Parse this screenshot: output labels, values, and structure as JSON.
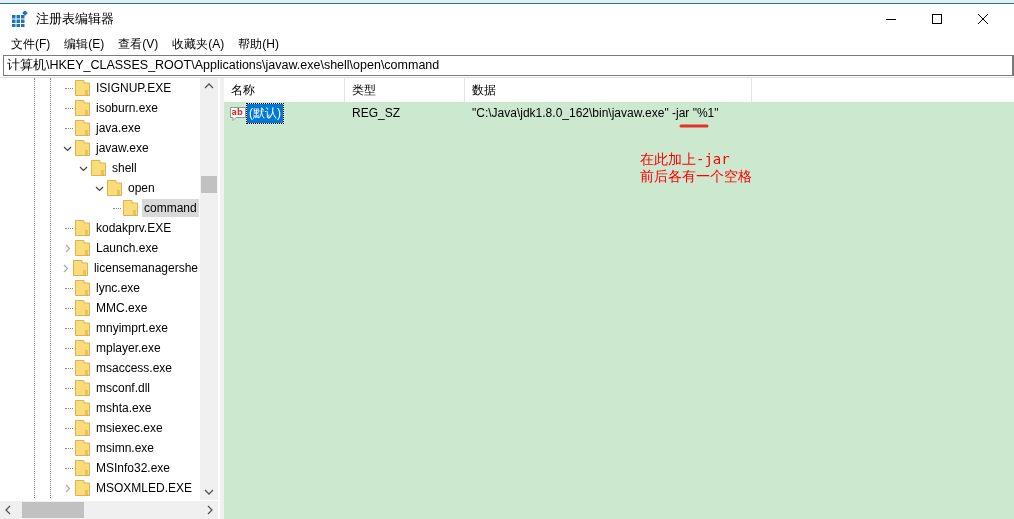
{
  "window": {
    "title": "注册表编辑器"
  },
  "menu": [
    "文件(F)",
    "编辑(E)",
    "查看(V)",
    "收藏夹(A)",
    "帮助(H)"
  ],
  "address": "计算机\\HKEY_CLASSES_ROOT\\Applications\\javaw.exe\\shell\\open\\command",
  "tree": [
    {
      "label": "ISIGNUP.EXE",
      "kind": "leaf",
      "selected": false
    },
    {
      "label": "isoburn.exe",
      "kind": "leaf",
      "selected": false
    },
    {
      "label": "java.exe",
      "kind": "leaf",
      "selected": false
    },
    {
      "label": "javaw.exe",
      "kind": "branch",
      "expanded": true,
      "selected": false,
      "children": [
        {
          "label": "shell",
          "kind": "branch",
          "expanded": true,
          "selected": false,
          "children": [
            {
              "label": "open",
              "kind": "branch",
              "expanded": true,
              "selected": false,
              "children": [
                {
                  "label": "command",
                  "kind": "leaf",
                  "selected": true
                }
              ]
            }
          ]
        }
      ]
    },
    {
      "label": "kodakprv.EXE",
      "kind": "leaf",
      "selected": false
    },
    {
      "label": "Launch.exe",
      "kind": "branch",
      "expanded": false,
      "selected": false
    },
    {
      "label": "licensemanagershe",
      "kind": "branch",
      "expanded": false,
      "selected": false
    },
    {
      "label": "lync.exe",
      "kind": "leaf",
      "selected": false
    },
    {
      "label": "MMC.exe",
      "kind": "leaf",
      "selected": false
    },
    {
      "label": "mnyimprt.exe",
      "kind": "leaf",
      "selected": false
    },
    {
      "label": "mplayer.exe",
      "kind": "leaf",
      "selected": false
    },
    {
      "label": "msaccess.exe",
      "kind": "leaf",
      "selected": false
    },
    {
      "label": "msconf.dll",
      "kind": "leaf",
      "selected": false
    },
    {
      "label": "mshta.exe",
      "kind": "leaf",
      "selected": false
    },
    {
      "label": "msiexec.exe",
      "kind": "leaf",
      "selected": false
    },
    {
      "label": "msimn.exe",
      "kind": "leaf",
      "selected": false
    },
    {
      "label": "MSInfo32.exe",
      "kind": "leaf",
      "selected": false
    },
    {
      "label": "MSOXMLED.EXE",
      "kind": "branch",
      "expanded": false,
      "selected": false
    }
  ],
  "table": {
    "columns": [
      "名称",
      "类型",
      "数据"
    ],
    "rows": [
      {
        "icon_label": "ab",
        "name": "(默认)",
        "type": "REG_SZ",
        "data": "\"C:\\Java\\jdk1.8.0_162\\bin\\javaw.exe\" -jar \"%1\"",
        "selected": true
      }
    ]
  },
  "annotation": {
    "lines": [
      "在此加上-jar",
      "前后各有一个空格"
    ]
  }
}
